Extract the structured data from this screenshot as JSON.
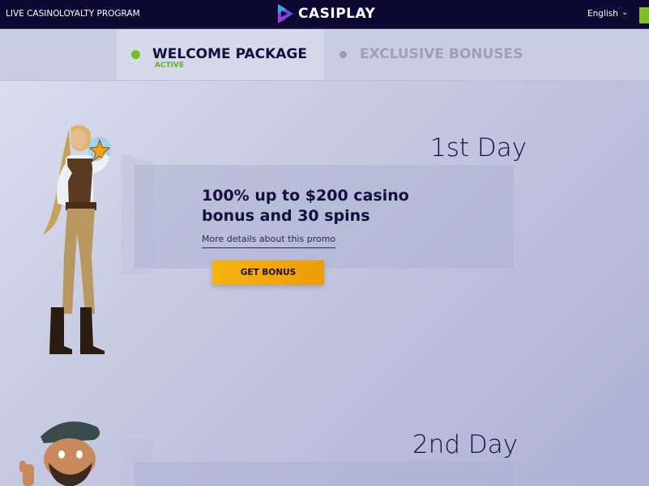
{
  "nav": {
    "live_casino": "LIVE CASINO",
    "loyalty_program": "LOYALTY PROGRAM",
    "logo_text": "CASIPLAY",
    "language": "English"
  },
  "tabs": [
    {
      "label": "WELCOME PACKAGE",
      "status": "ACTIVE"
    },
    {
      "label": "EXCLUSIVE BONUSES"
    }
  ],
  "days": [
    {
      "title": "1st Day",
      "headline_line1": "100% up to $200 casino",
      "headline_line2": "bonus and 30 spins",
      "details_link": "More details about this promo",
      "button": "GET BONUS"
    },
    {
      "title": "2nd Day"
    }
  ],
  "colors": {
    "topbar": "#0d0933",
    "accent_green": "#7ec021",
    "button_orange": "#f3b510",
    "text_dark": "#131040"
  }
}
